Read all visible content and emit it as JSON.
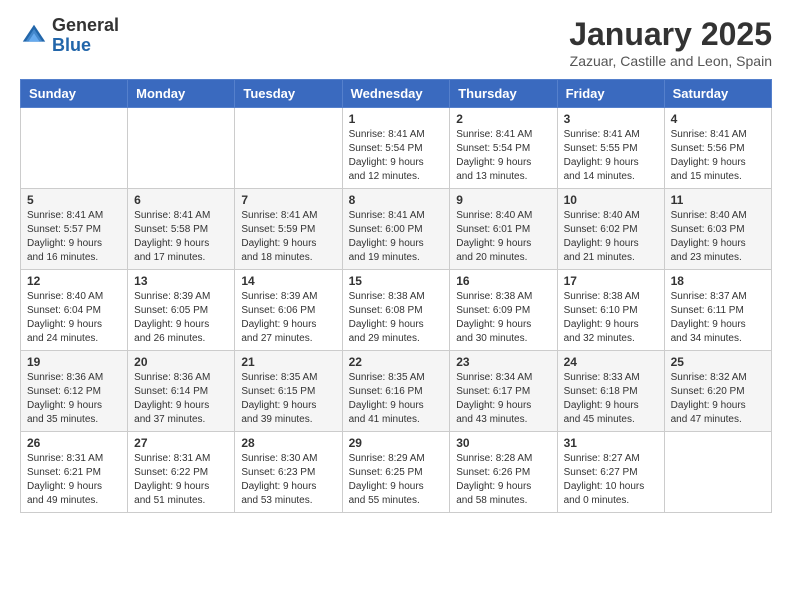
{
  "logo": {
    "general": "General",
    "blue": "Blue"
  },
  "title": "January 2025",
  "subtitle": "Zazuar, Castille and Leon, Spain",
  "days_of_week": [
    "Sunday",
    "Monday",
    "Tuesday",
    "Wednesday",
    "Thursday",
    "Friday",
    "Saturday"
  ],
  "weeks": [
    {
      "days": [
        {
          "number": "",
          "info": ""
        },
        {
          "number": "",
          "info": ""
        },
        {
          "number": "",
          "info": ""
        },
        {
          "number": "1",
          "info": "Sunrise: 8:41 AM\nSunset: 5:54 PM\nDaylight: 9 hours\nand 12 minutes."
        },
        {
          "number": "2",
          "info": "Sunrise: 8:41 AM\nSunset: 5:54 PM\nDaylight: 9 hours\nand 13 minutes."
        },
        {
          "number": "3",
          "info": "Sunrise: 8:41 AM\nSunset: 5:55 PM\nDaylight: 9 hours\nand 14 minutes."
        },
        {
          "number": "4",
          "info": "Sunrise: 8:41 AM\nSunset: 5:56 PM\nDaylight: 9 hours\nand 15 minutes."
        }
      ]
    },
    {
      "days": [
        {
          "number": "5",
          "info": "Sunrise: 8:41 AM\nSunset: 5:57 PM\nDaylight: 9 hours\nand 16 minutes."
        },
        {
          "number": "6",
          "info": "Sunrise: 8:41 AM\nSunset: 5:58 PM\nDaylight: 9 hours\nand 17 minutes."
        },
        {
          "number": "7",
          "info": "Sunrise: 8:41 AM\nSunset: 5:59 PM\nDaylight: 9 hours\nand 18 minutes."
        },
        {
          "number": "8",
          "info": "Sunrise: 8:41 AM\nSunset: 6:00 PM\nDaylight: 9 hours\nand 19 minutes."
        },
        {
          "number": "9",
          "info": "Sunrise: 8:40 AM\nSunset: 6:01 PM\nDaylight: 9 hours\nand 20 minutes."
        },
        {
          "number": "10",
          "info": "Sunrise: 8:40 AM\nSunset: 6:02 PM\nDaylight: 9 hours\nand 21 minutes."
        },
        {
          "number": "11",
          "info": "Sunrise: 8:40 AM\nSunset: 6:03 PM\nDaylight: 9 hours\nand 23 minutes."
        }
      ]
    },
    {
      "days": [
        {
          "number": "12",
          "info": "Sunrise: 8:40 AM\nSunset: 6:04 PM\nDaylight: 9 hours\nand 24 minutes."
        },
        {
          "number": "13",
          "info": "Sunrise: 8:39 AM\nSunset: 6:05 PM\nDaylight: 9 hours\nand 26 minutes."
        },
        {
          "number": "14",
          "info": "Sunrise: 8:39 AM\nSunset: 6:06 PM\nDaylight: 9 hours\nand 27 minutes."
        },
        {
          "number": "15",
          "info": "Sunrise: 8:38 AM\nSunset: 6:08 PM\nDaylight: 9 hours\nand 29 minutes."
        },
        {
          "number": "16",
          "info": "Sunrise: 8:38 AM\nSunset: 6:09 PM\nDaylight: 9 hours\nand 30 minutes."
        },
        {
          "number": "17",
          "info": "Sunrise: 8:38 AM\nSunset: 6:10 PM\nDaylight: 9 hours\nand 32 minutes."
        },
        {
          "number": "18",
          "info": "Sunrise: 8:37 AM\nSunset: 6:11 PM\nDaylight: 9 hours\nand 34 minutes."
        }
      ]
    },
    {
      "days": [
        {
          "number": "19",
          "info": "Sunrise: 8:36 AM\nSunset: 6:12 PM\nDaylight: 9 hours\nand 35 minutes."
        },
        {
          "number": "20",
          "info": "Sunrise: 8:36 AM\nSunset: 6:14 PM\nDaylight: 9 hours\nand 37 minutes."
        },
        {
          "number": "21",
          "info": "Sunrise: 8:35 AM\nSunset: 6:15 PM\nDaylight: 9 hours\nand 39 minutes."
        },
        {
          "number": "22",
          "info": "Sunrise: 8:35 AM\nSunset: 6:16 PM\nDaylight: 9 hours\nand 41 minutes."
        },
        {
          "number": "23",
          "info": "Sunrise: 8:34 AM\nSunset: 6:17 PM\nDaylight: 9 hours\nand 43 minutes."
        },
        {
          "number": "24",
          "info": "Sunrise: 8:33 AM\nSunset: 6:18 PM\nDaylight: 9 hours\nand 45 minutes."
        },
        {
          "number": "25",
          "info": "Sunrise: 8:32 AM\nSunset: 6:20 PM\nDaylight: 9 hours\nand 47 minutes."
        }
      ]
    },
    {
      "days": [
        {
          "number": "26",
          "info": "Sunrise: 8:31 AM\nSunset: 6:21 PM\nDaylight: 9 hours\nand 49 minutes."
        },
        {
          "number": "27",
          "info": "Sunrise: 8:31 AM\nSunset: 6:22 PM\nDaylight: 9 hours\nand 51 minutes."
        },
        {
          "number": "28",
          "info": "Sunrise: 8:30 AM\nSunset: 6:23 PM\nDaylight: 9 hours\nand 53 minutes."
        },
        {
          "number": "29",
          "info": "Sunrise: 8:29 AM\nSunset: 6:25 PM\nDaylight: 9 hours\nand 55 minutes."
        },
        {
          "number": "30",
          "info": "Sunrise: 8:28 AM\nSunset: 6:26 PM\nDaylight: 9 hours\nand 58 minutes."
        },
        {
          "number": "31",
          "info": "Sunrise: 8:27 AM\nSunset: 6:27 PM\nDaylight: 10 hours\nand 0 minutes."
        },
        {
          "number": "",
          "info": ""
        }
      ]
    }
  ]
}
